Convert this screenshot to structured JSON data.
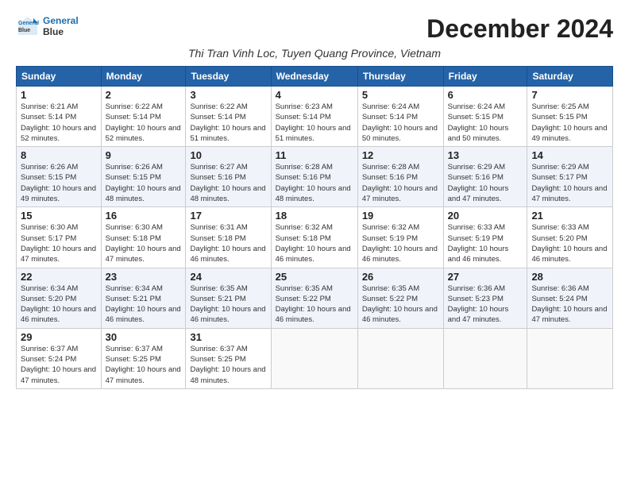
{
  "header": {
    "logo_line1": "General",
    "logo_line2": "Blue",
    "month_title": "December 2024",
    "location": "Thi Tran Vinh Loc, Tuyen Quang Province, Vietnam"
  },
  "weekdays": [
    "Sunday",
    "Monday",
    "Tuesday",
    "Wednesday",
    "Thursday",
    "Friday",
    "Saturday"
  ],
  "weeks": [
    [
      {
        "day": "1",
        "sunrise": "6:21 AM",
        "sunset": "5:14 PM",
        "daylight": "10 hours and 52 minutes."
      },
      {
        "day": "2",
        "sunrise": "6:22 AM",
        "sunset": "5:14 PM",
        "daylight": "10 hours and 52 minutes."
      },
      {
        "day": "3",
        "sunrise": "6:22 AM",
        "sunset": "5:14 PM",
        "daylight": "10 hours and 51 minutes."
      },
      {
        "day": "4",
        "sunrise": "6:23 AM",
        "sunset": "5:14 PM",
        "daylight": "10 hours and 51 minutes."
      },
      {
        "day": "5",
        "sunrise": "6:24 AM",
        "sunset": "5:14 PM",
        "daylight": "10 hours and 50 minutes."
      },
      {
        "day": "6",
        "sunrise": "6:24 AM",
        "sunset": "5:15 PM",
        "daylight": "10 hours and 50 minutes."
      },
      {
        "day": "7",
        "sunrise": "6:25 AM",
        "sunset": "5:15 PM",
        "daylight": "10 hours and 49 minutes."
      }
    ],
    [
      {
        "day": "8",
        "sunrise": "6:26 AM",
        "sunset": "5:15 PM",
        "daylight": "10 hours and 49 minutes."
      },
      {
        "day": "9",
        "sunrise": "6:26 AM",
        "sunset": "5:15 PM",
        "daylight": "10 hours and 48 minutes."
      },
      {
        "day": "10",
        "sunrise": "6:27 AM",
        "sunset": "5:16 PM",
        "daylight": "10 hours and 48 minutes."
      },
      {
        "day": "11",
        "sunrise": "6:28 AM",
        "sunset": "5:16 PM",
        "daylight": "10 hours and 48 minutes."
      },
      {
        "day": "12",
        "sunrise": "6:28 AM",
        "sunset": "5:16 PM",
        "daylight": "10 hours and 47 minutes."
      },
      {
        "day": "13",
        "sunrise": "6:29 AM",
        "sunset": "5:16 PM",
        "daylight": "10 hours and 47 minutes."
      },
      {
        "day": "14",
        "sunrise": "6:29 AM",
        "sunset": "5:17 PM",
        "daylight": "10 hours and 47 minutes."
      }
    ],
    [
      {
        "day": "15",
        "sunrise": "6:30 AM",
        "sunset": "5:17 PM",
        "daylight": "10 hours and 47 minutes."
      },
      {
        "day": "16",
        "sunrise": "6:30 AM",
        "sunset": "5:18 PM",
        "daylight": "10 hours and 47 minutes."
      },
      {
        "day": "17",
        "sunrise": "6:31 AM",
        "sunset": "5:18 PM",
        "daylight": "10 hours and 46 minutes."
      },
      {
        "day": "18",
        "sunrise": "6:32 AM",
        "sunset": "5:18 PM",
        "daylight": "10 hours and 46 minutes."
      },
      {
        "day": "19",
        "sunrise": "6:32 AM",
        "sunset": "5:19 PM",
        "daylight": "10 hours and 46 minutes."
      },
      {
        "day": "20",
        "sunrise": "6:33 AM",
        "sunset": "5:19 PM",
        "daylight": "10 hours and 46 minutes."
      },
      {
        "day": "21",
        "sunrise": "6:33 AM",
        "sunset": "5:20 PM",
        "daylight": "10 hours and 46 minutes."
      }
    ],
    [
      {
        "day": "22",
        "sunrise": "6:34 AM",
        "sunset": "5:20 PM",
        "daylight": "10 hours and 46 minutes."
      },
      {
        "day": "23",
        "sunrise": "6:34 AM",
        "sunset": "5:21 PM",
        "daylight": "10 hours and 46 minutes."
      },
      {
        "day": "24",
        "sunrise": "6:35 AM",
        "sunset": "5:21 PM",
        "daylight": "10 hours and 46 minutes."
      },
      {
        "day": "25",
        "sunrise": "6:35 AM",
        "sunset": "5:22 PM",
        "daylight": "10 hours and 46 minutes."
      },
      {
        "day": "26",
        "sunrise": "6:35 AM",
        "sunset": "5:22 PM",
        "daylight": "10 hours and 46 minutes."
      },
      {
        "day": "27",
        "sunrise": "6:36 AM",
        "sunset": "5:23 PM",
        "daylight": "10 hours and 47 minutes."
      },
      {
        "day": "28",
        "sunrise": "6:36 AM",
        "sunset": "5:24 PM",
        "daylight": "10 hours and 47 minutes."
      }
    ],
    [
      {
        "day": "29",
        "sunrise": "6:37 AM",
        "sunset": "5:24 PM",
        "daylight": "10 hours and 47 minutes."
      },
      {
        "day": "30",
        "sunrise": "6:37 AM",
        "sunset": "5:25 PM",
        "daylight": "10 hours and 47 minutes."
      },
      {
        "day": "31",
        "sunrise": "6:37 AM",
        "sunset": "5:25 PM",
        "daylight": "10 hours and 48 minutes."
      },
      null,
      null,
      null,
      null
    ]
  ]
}
